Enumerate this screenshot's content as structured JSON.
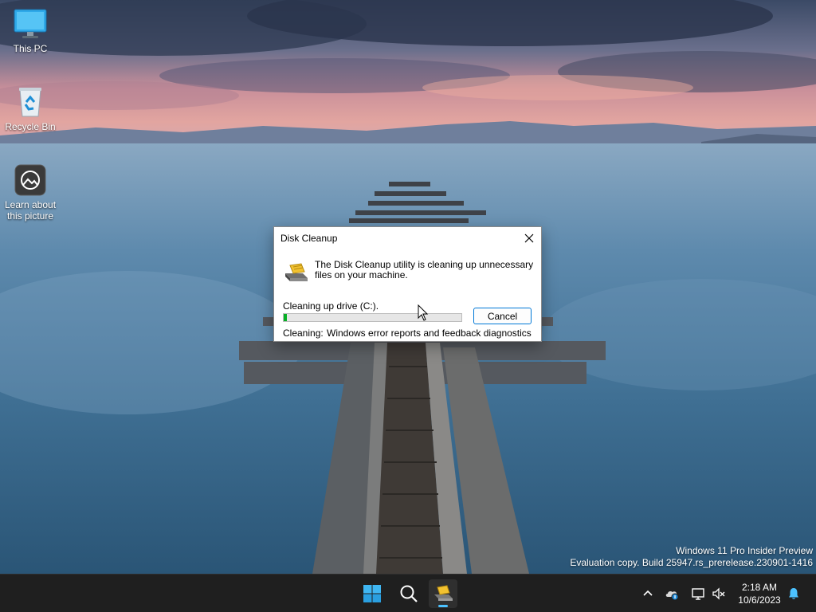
{
  "desktop": {
    "icons": [
      {
        "label": "This PC",
        "icon": "monitor-icon"
      },
      {
        "label": "Recycle Bin",
        "icon": "recycle-bin-icon"
      },
      {
        "label_line1": "Learn about",
        "label_line2": "this picture",
        "icon": "camera-icon"
      }
    ]
  },
  "watermark": {
    "line1": "Windows 11 Pro Insider Preview",
    "line2": "Evaluation copy. Build 25947.rs_prerelease.230901-1416"
  },
  "dialog": {
    "title": "Disk Cleanup",
    "message": "The Disk Cleanup utility is cleaning up unnecessary files on your machine.",
    "drive_label": "Cleaning up drive  (C:).",
    "progress_fraction": 0.02,
    "cancel_label": "Cancel",
    "cleaning_label": "Cleaning:",
    "cleaning_item": "Windows error reports and feedback diagnostics"
  },
  "taskbar": {
    "items": [
      {
        "icon": "windows-start-icon"
      },
      {
        "icon": "search-icon"
      },
      {
        "icon": "disk-cleanup-icon",
        "active": true
      }
    ],
    "tray": {
      "icons": [
        "chevron-up-icon",
        "cloud-icon",
        "network-icon",
        "volume-muted-icon",
        "notification-bell-icon"
      ],
      "time": "2:18 AM",
      "date": "10/6/2023"
    }
  },
  "colors": {
    "accent": "#0078d7",
    "progress": "#06b025",
    "taskbar": "#1f1f1f",
    "active_indicator": "#4cc2ff"
  }
}
